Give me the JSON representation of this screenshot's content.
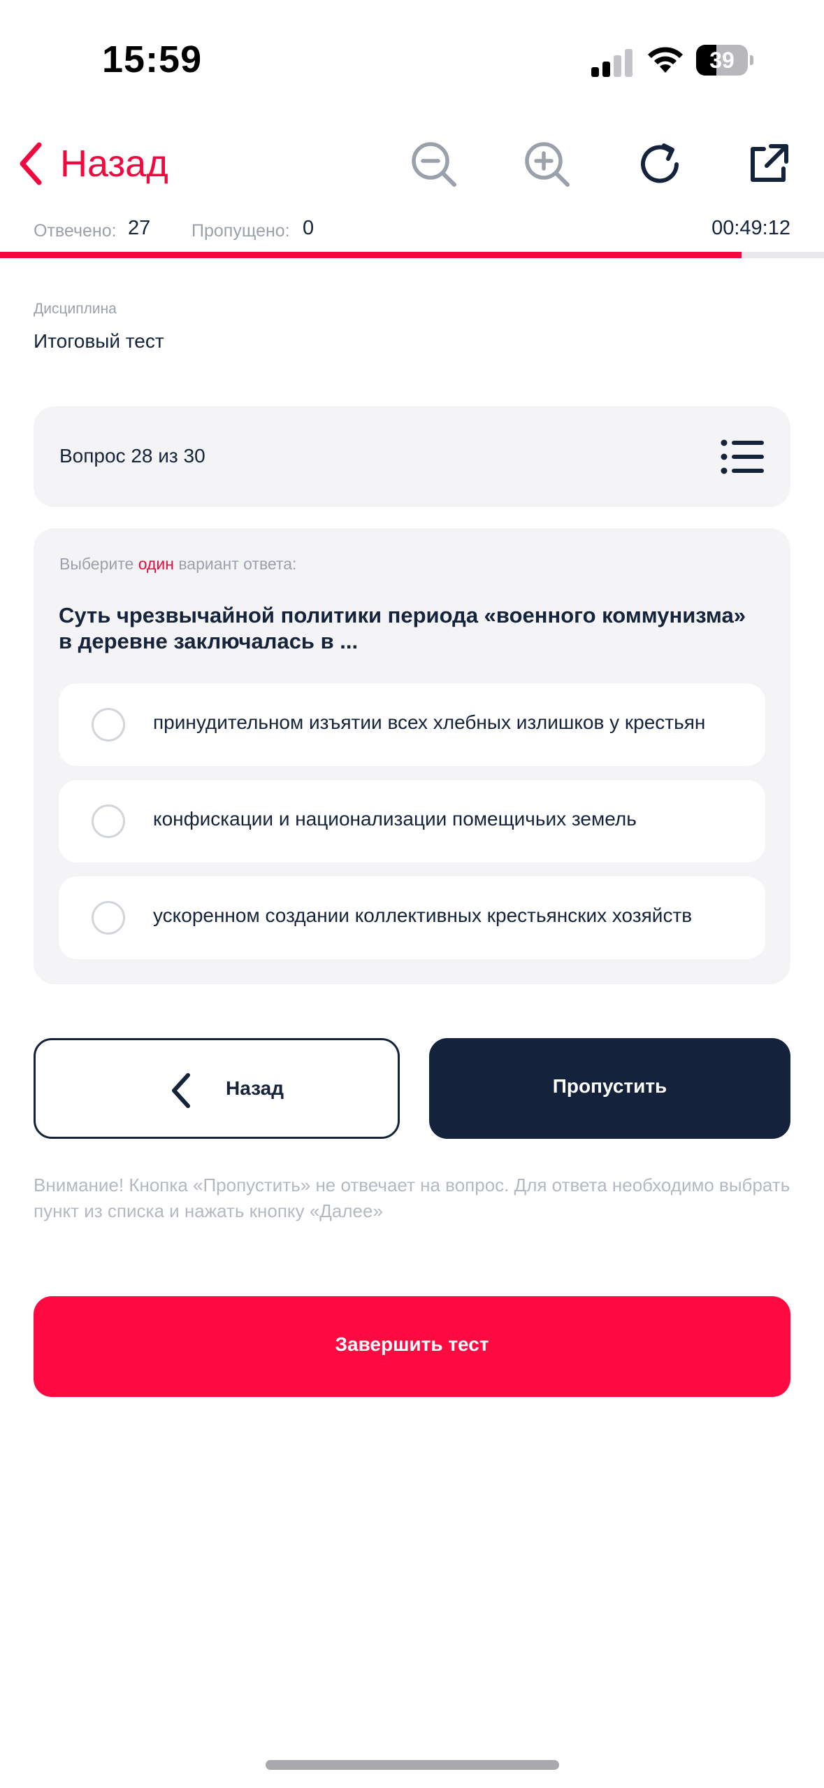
{
  "status_bar": {
    "time": "15:59",
    "battery_level": "39",
    "battery_fraction": 0.39,
    "signal_bars_active": 2,
    "icons": [
      "cellular-signal-icon",
      "wifi-icon",
      "battery-icon"
    ]
  },
  "toolbar": {
    "back_label": "Назад",
    "icons": [
      "chevron-left-icon",
      "zoom-out-icon",
      "zoom-in-icon",
      "refresh-icon",
      "external-link-icon"
    ]
  },
  "counters": {
    "answered_label": "Отвечено:",
    "answered_value": "27",
    "skipped_label": "Пропущено:",
    "skipped_value": "0",
    "timer": "00:49:12"
  },
  "progress": {
    "fraction": 0.9
  },
  "discipline": {
    "label": "Дисциплина",
    "value": "Итоговый тест"
  },
  "question_header": {
    "label": "Вопрос 28 из 30",
    "icon": "list-icon"
  },
  "question": {
    "instruction_prefix": "Выберите ",
    "instruction_accent": "один",
    "instruction_suffix": " вариант ответа:",
    "text": "Суть чрезвычайной политики периода «военного коммунизма» в деревне заключалась в ...",
    "options": [
      {
        "label": "принудительном изъятии всех хлебных излишков у крестьян",
        "selected": false
      },
      {
        "label": "конфискации и национализации помещичьих земель",
        "selected": false
      },
      {
        "label": "ускоренном создании коллективных крестьянских хозяйств",
        "selected": false
      }
    ]
  },
  "actions": {
    "back_label": "Назад",
    "skip_label": "Пропустить",
    "finish_label": "Завершить тест"
  },
  "note": "Внимание! Кнопка «Пропустить» не отвечает на вопрос. Для ответа необходимо выбрать пункт из списка и нажать кнопку «Далее»",
  "colors": {
    "accent": "#f0083f",
    "finish_button": "#ff0a40",
    "dark": "#14233b",
    "muted": "#9aa1ab",
    "card_bg": "#f4f4f6"
  }
}
